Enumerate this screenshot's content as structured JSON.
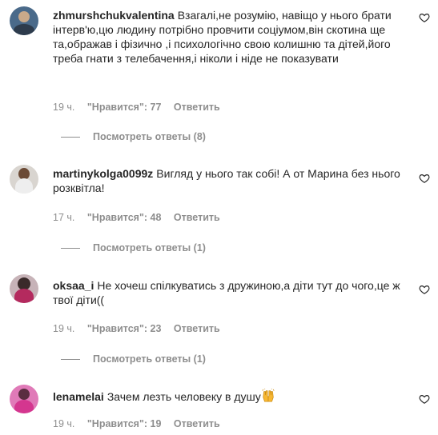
{
  "comments": [
    {
      "user": "zhmurshchukvalentina",
      "text": "Взагалі,не розумію, навіщо у нього брати інтерв'ю,цю людину потрібно провчити соціумом,він скотина ще та,ображав і фізично ,і психологічно свою колишню та дітей,його треба гнати з телебачення,і ніколи і ніде не показувати",
      "time": "19 ч.",
      "likes": "\"Нравится\": 77",
      "reply": "Ответить",
      "view_replies": "Посмотреть ответы (8)"
    },
    {
      "user": "martinykolga0099z",
      "text": "Вигляд у нього так собі! А от Марина без нього розквітла!",
      "time": "17 ч.",
      "likes": "\"Нравится\": 48",
      "reply": "Ответить",
      "view_replies": "Посмотреть ответы (1)"
    },
    {
      "user": "oksaa_i",
      "text": "Не хочеш спілкуватись з дружиною,а діти тут до чого,це ж твої діти((",
      "time": "19 ч.",
      "likes": "\"Нравится\": 23",
      "reply": "Ответить",
      "view_replies": "Посмотреть ответы (1)"
    },
    {
      "user": "lenamelai",
      "text": "Зачем лезть человеку в душу",
      "emoji": "raising-hands-emoji",
      "time": "19 ч.",
      "likes": "\"Нравится\": 19",
      "reply": "Ответить"
    }
  ],
  "colors": {
    "text": "#262626",
    "muted": "#8e8e8e",
    "background": "#ffffff"
  }
}
